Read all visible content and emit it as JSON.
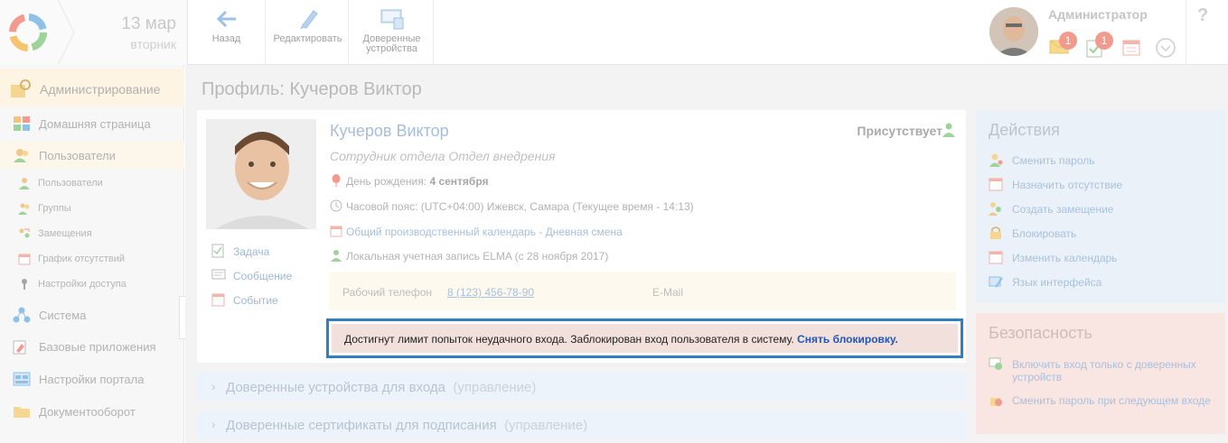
{
  "topbar": {
    "date_day": "13 мар",
    "date_weekday": "вторник",
    "buttons": {
      "back": "Назад",
      "edit": "Редактировать",
      "trusted_line1": "Доверенные",
      "trusted_line2": "устройства"
    },
    "user_name": "Администратор",
    "messages_count": "1",
    "tasks_count": "1",
    "help": "?"
  },
  "sidebar": {
    "header": "Администрирование",
    "items": {
      "home": "Домашняя страница",
      "users": "Пользователи",
      "system": "Система",
      "apps": "Базовые приложения",
      "portal": "Настройки портала",
      "docflow": "Документооборот"
    },
    "subitems": {
      "users": "Пользователи",
      "groups": "Группы",
      "replacements": "Замещения",
      "absence": "График отсутствий",
      "access": "Настройки доступа"
    }
  },
  "main": {
    "page_title": "Профиль: Кучеров Виктор",
    "profile": {
      "name": "Кучеров Виктор",
      "status": "Присутствует",
      "position": "Сотрудник отдела Отдел внедрения",
      "birthday_label": "День рождения:",
      "birthday_value": "4 сентября",
      "timezone": "Часовой пояс: (UTC+04:00) Ижевск, Самара (Текущее время - 14:13)",
      "calendar": "Общий производственный календарь - Дневная смена",
      "account": "Локальная учетная запись ELMA  (с 28 ноября 2017)"
    },
    "quick_actions": {
      "task": "Задача",
      "message": "Сообщение",
      "event": "Событие"
    },
    "contacts": {
      "phone_label": "Рабочий телефон",
      "phone_value": "8 (123) 456-78-90",
      "email_label": "E-Mail"
    },
    "alert": {
      "text": "Достигнут лимит попыток неудачного входа. Заблокирован вход пользователя в систему.",
      "link": "Снять блокировку."
    },
    "sections": {
      "devices": "Доверенные устройства для входа",
      "devices_manage": "(управление)",
      "certs": "Доверенные сертификаты для подписания",
      "certs_manage": "(управление)"
    }
  },
  "actions_panel": {
    "title": "Действия",
    "items": {
      "change_password": "Сменить пароль",
      "set_absence": "Назначить отсутствие",
      "create_replacement": "Создать замещение",
      "block": "Блокировать",
      "change_calendar": "Изменить календарь",
      "interface_lang": "Язык интерфейса"
    }
  },
  "security_panel": {
    "title": "Безопасность",
    "items": {
      "trusted_only": "Включить вход только с доверенных устройств",
      "change_next": "Сменить пароль при следующем входе"
    }
  },
  "colors": {
    "accent_blue": "#2f7fc1",
    "alert_bg": "#f2e0dc",
    "link_blue": "#1f56b7",
    "badge": "#f19a8e"
  }
}
